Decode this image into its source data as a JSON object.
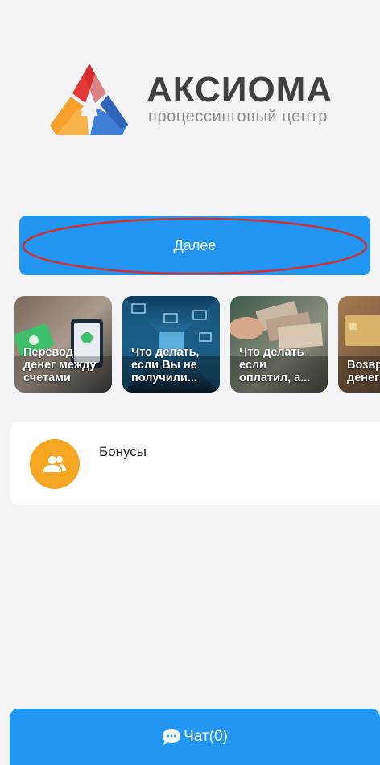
{
  "brand": {
    "name": "АКСИОМА",
    "tagline": "процессинговый центр",
    "colors": {
      "red": "#e53935",
      "orange": "#f5a02a",
      "blue": "#3f7fd6",
      "text": "#3f3f44"
    }
  },
  "next_button": {
    "label": "Далее"
  },
  "highlight": {
    "shape": "ellipse",
    "color": "#d32f2f"
  },
  "stories": [
    {
      "lines": [
        "Перевод",
        "денег между",
        "счетами"
      ],
      "image": "hands-with-phones-photo"
    },
    {
      "lines": [
        "Что делать,",
        "если Вы не",
        "получили..."
      ],
      "image": "server-room-mail-photo"
    },
    {
      "lines": [
        "Что делать",
        "если",
        "оплатил, а..."
      ],
      "image": "hands-counting-cash-photo"
    },
    {
      "lines": [
        "Возвр",
        "денег"
      ],
      "image": "bank-card-photo"
    }
  ],
  "bonus": {
    "label": "Бонусы",
    "icon": "users-icon",
    "icon_color": "#f5a623"
  },
  "chat": {
    "label": "Чат(0)",
    "icon": "chat-bubble-icon"
  },
  "accent_color": "#2196f3"
}
